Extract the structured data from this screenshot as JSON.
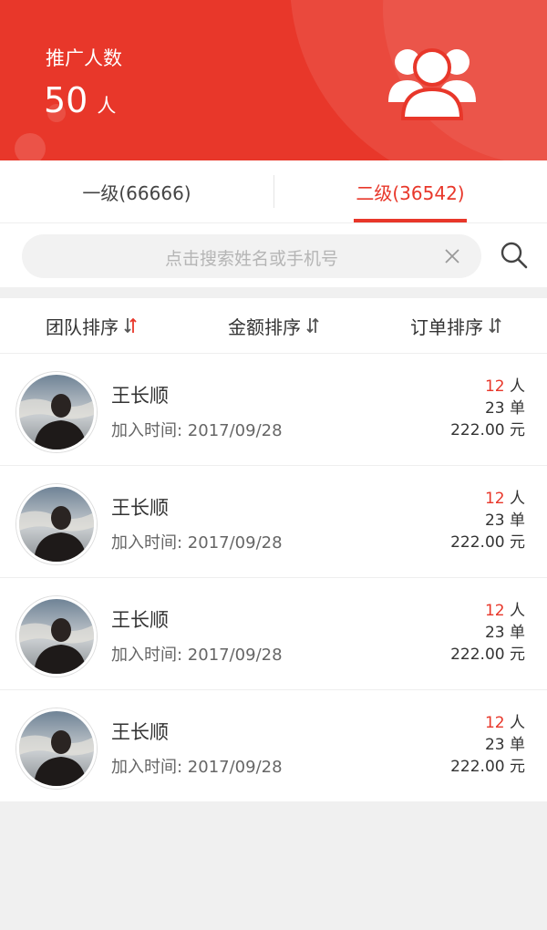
{
  "header": {
    "label": "推广人数",
    "count": "50",
    "unit": "人",
    "icon": "team-icon"
  },
  "tabs": [
    {
      "label": "一级(66666)",
      "active": false
    },
    {
      "label": "二级(36542)",
      "active": true
    }
  ],
  "search": {
    "placeholder": "点击搜索姓名或手机号"
  },
  "sort": [
    {
      "label": "团队排序"
    },
    {
      "label": "金额排序"
    },
    {
      "label": "订单排序"
    }
  ],
  "members": [
    {
      "name": "王长顺",
      "joined": "加入时间: 2017/09/28",
      "people": "12",
      "people_unit": "人",
      "orders": "23",
      "orders_unit": "单",
      "amount": "222.00",
      "amount_unit": "元"
    },
    {
      "name": "王长顺",
      "joined": "加入时间: 2017/09/28",
      "people": "12",
      "people_unit": "人",
      "orders": "23",
      "orders_unit": "单",
      "amount": "222.00",
      "amount_unit": "元"
    },
    {
      "name": "王长顺",
      "joined": "加入时间: 2017/09/28",
      "people": "12",
      "people_unit": "人",
      "orders": "23",
      "orders_unit": "单",
      "amount": "222.00",
      "amount_unit": "元"
    },
    {
      "name": "王长顺",
      "joined": "加入时间: 2017/09/28",
      "people": "12",
      "people_unit": "人",
      "orders": "23",
      "orders_unit": "单",
      "amount": "222.00",
      "amount_unit": "元"
    }
  ],
  "colors": {
    "accent": "#e8372a",
    "background": "#f0f0f0"
  }
}
